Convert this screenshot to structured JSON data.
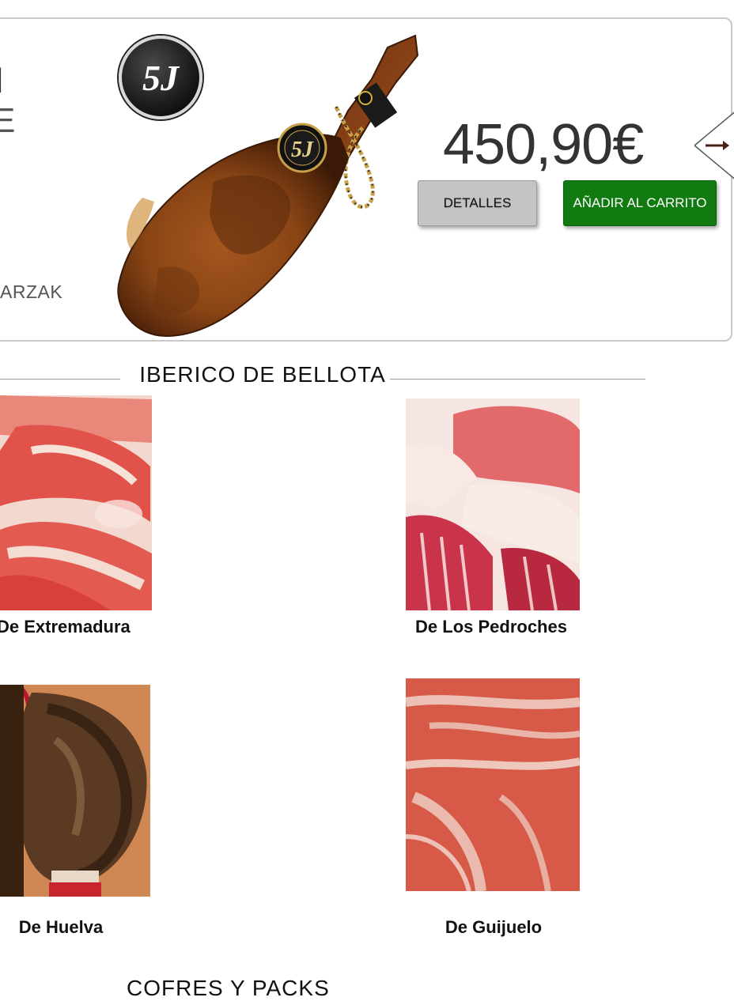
{
  "featured": {
    "title_fragment_1": "l",
    "title_fragment_2": "E",
    "brand_fragment": "ARZAK",
    "logo_text": "5J",
    "price": "450,90€",
    "details_label": "DETALLES",
    "cart_label": "AÑADIR AL CARRITO",
    "colors": {
      "cart_green": "#117a11",
      "details_grey": "#c4c4c4"
    }
  },
  "sections": [
    {
      "title": "IBERICO DE BELLOTA",
      "items": [
        {
          "label": "De Extremadura",
          "image": "sliced-ham-photo"
        },
        {
          "label": "De Los Pedroches",
          "image": "sliced-ham-photo"
        },
        {
          "label": "De Huelva",
          "image": "whole-ham-photo"
        },
        {
          "label": "De Guijuelo",
          "image": "sliced-ham-photo"
        }
      ]
    },
    {
      "title": "COFRES Y PACKS"
    }
  ]
}
